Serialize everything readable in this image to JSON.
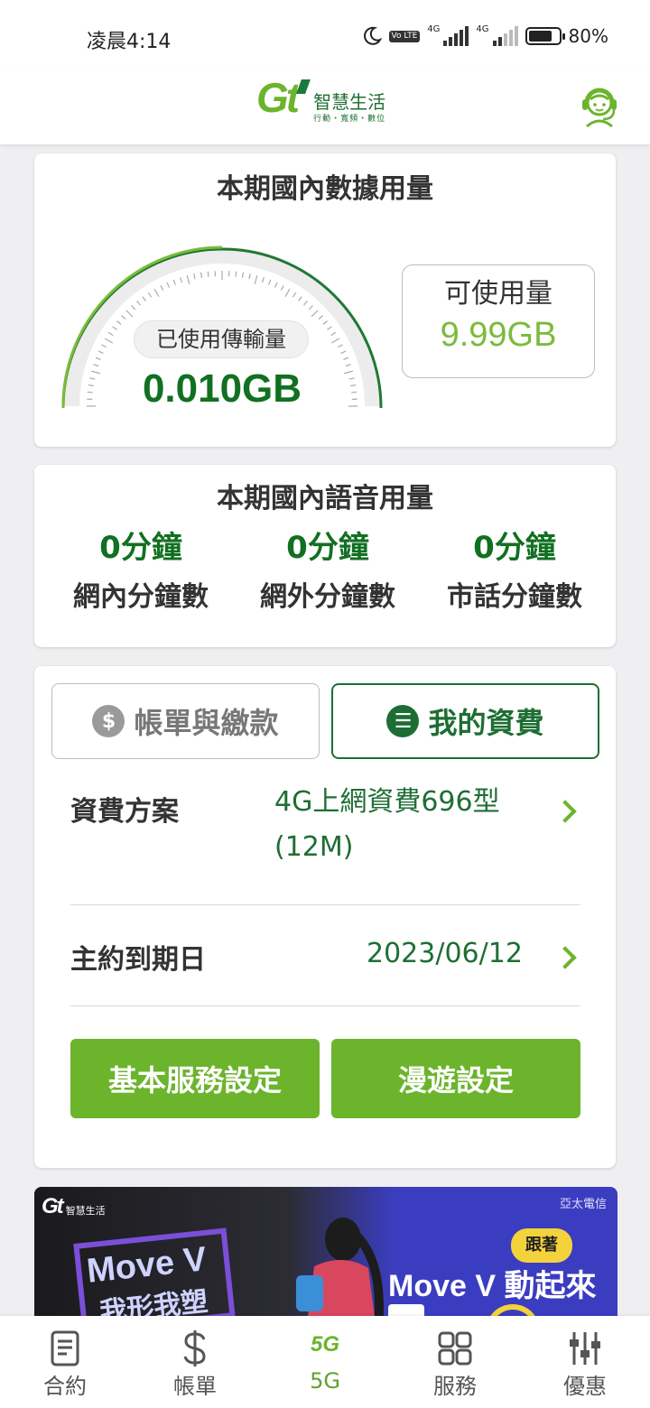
{
  "status_bar": {
    "time": "凌晨4:14",
    "network_a": "4G",
    "network_b": "4G",
    "volte": "Vo LTE",
    "battery": "80%",
    "battery_level": 0.8
  },
  "header": {
    "logo_gt": "Gt",
    "logo_title": "智慧生活",
    "logo_sub": "行動・寬頻・數位"
  },
  "data_usage": {
    "title": "本期國內數據用量",
    "used_label": "已使用傳輸量",
    "used_value": "0.010GB",
    "available_label": "可使用量",
    "available_value": "9.99GB",
    "used_fraction": 0.001
  },
  "voice_usage": {
    "title": "本期國內語音用量",
    "items": [
      {
        "value": "0分鐘",
        "label": "網內分鐘數"
      },
      {
        "value": "0分鐘",
        "label": "網外分鐘數"
      },
      {
        "value": "0分鐘",
        "label": "市話分鐘數"
      }
    ]
  },
  "plan": {
    "tabs": [
      {
        "label": "帳單與繳款",
        "icon": "dollar-icon",
        "icon_glyph": "$"
      },
      {
        "label": "我的資費",
        "icon": "list-icon",
        "icon_glyph": "☰"
      }
    ],
    "rows": [
      {
        "label": "資費方案",
        "value_line1": "4G上網資費696型",
        "value_line2": "(12M)"
      },
      {
        "label": "主約到期日",
        "value_line1": "2023/06/12"
      }
    ],
    "buttons": {
      "basic": "基本服務設定",
      "roaming": "漫遊設定"
    }
  },
  "banner": {
    "logo_gt": "Gt",
    "logo_title": "智慧生活",
    "brand": "亞太電信",
    "headline": "Move V",
    "headline_sub": "我形我塑",
    "badge": "跟著",
    "slogan": "Move V 動起來"
  },
  "bottom_nav": [
    {
      "label": "合約",
      "icon": "contract-icon"
    },
    {
      "label": "帳單",
      "icon": "dollar-icon"
    },
    {
      "label": "5G",
      "icon": "5g-icon",
      "icon_text": "5G",
      "active": true
    },
    {
      "label": "服務",
      "icon": "grid-icon"
    },
    {
      "label": "優惠",
      "icon": "sliders-icon"
    }
  ],
  "colors": {
    "brand_green": "#6cb42c",
    "dark_green": "#117021",
    "accent_green": "#7bbb3b"
  }
}
